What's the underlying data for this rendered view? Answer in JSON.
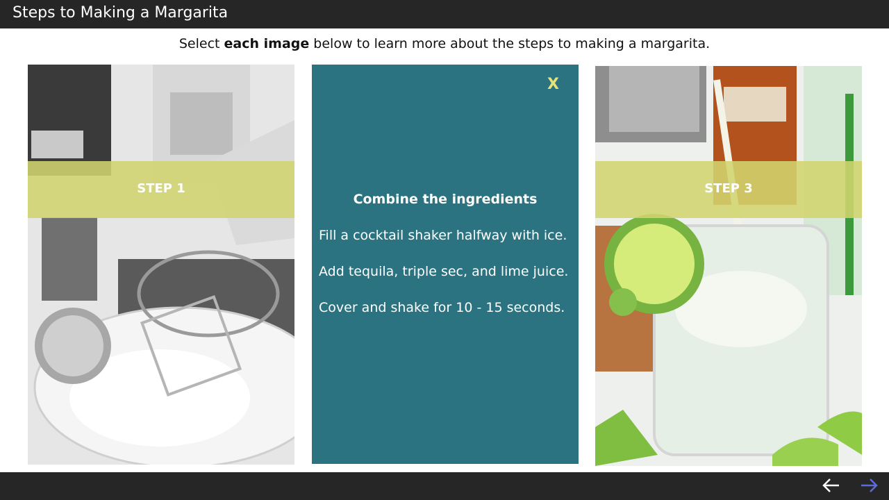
{
  "window": {
    "title": "Steps to Making a Margarita"
  },
  "instructions": {
    "pre": "Select ",
    "bold": "each image",
    "post": " below to learn more about the steps to making a margarita."
  },
  "cards": [
    {
      "label": "STEP 1"
    },
    {
      "label": "STEP 3"
    }
  ],
  "panel": {
    "close_label": "X",
    "heading": "Combine the ingredients",
    "lines": [
      "Fill a cocktail shaker halfway with ice.",
      "Add tequila, triple sec, and lime juice.",
      "Cover and shake for 10 - 15 seconds."
    ]
  },
  "colors": {
    "panel_bg": "#2b7380",
    "band": "#d2d46e",
    "close": "#e6e27a",
    "next_arrow": "#5b6bd8",
    "bar": "#262626"
  },
  "icons": {
    "back": "arrow-left-icon",
    "next": "arrow-right-icon"
  }
}
